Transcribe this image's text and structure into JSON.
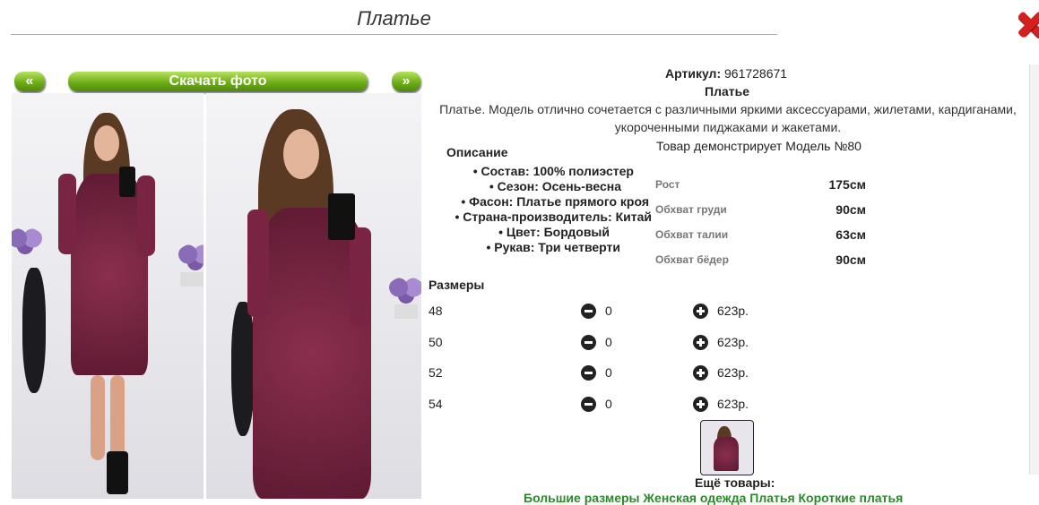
{
  "header": {
    "title": "Платье"
  },
  "gallery": {
    "prev_label": "«",
    "download_label": "Скачать фото",
    "next_label": "»"
  },
  "product": {
    "article_label": "Артикул:",
    "article_value": "961728671",
    "name": "Платье",
    "description_line1": "Платье. Модель отлично сочетается с различными яркими аксессуарами, жилетами, кардиганами,",
    "description_line2": "укороченными пиджаками и жакетами.",
    "model_note": "Товар демонстрирует Модель №80"
  },
  "specs": {
    "heading": "Описание",
    "items": [
      "• Состав: 100% полиэстер",
      "• Сезон: Осень-весна",
      "• Фасон: Платье прямого кроя",
      "• Страна-производитель: Китай",
      "• Цвет: Бордовый",
      "• Рукав: Три четверти"
    ]
  },
  "measurements": [
    {
      "label": "Рост",
      "value": "175см"
    },
    {
      "label": "Обхват груди",
      "value": "90см"
    },
    {
      "label": "Обхват талии",
      "value": "63см"
    },
    {
      "label": "Обхват бёдер",
      "value": "90см"
    }
  ],
  "sizes": {
    "heading": "Размеры",
    "rows": [
      {
        "size": "48",
        "qty": "0",
        "price": "623р."
      },
      {
        "size": "50",
        "qty": "0",
        "price": "623р."
      },
      {
        "size": "52",
        "qty": "0",
        "price": "623р."
      },
      {
        "size": "54",
        "qty": "0",
        "price": "623р."
      }
    ]
  },
  "more": {
    "heading": "Ещё товары:",
    "links_text": "Большие размеры   Женская одежда   Платья   Короткие платья"
  },
  "colors": {
    "accent_green": "#6fae18",
    "dress": "#6e1f3a",
    "close_red": "#d32020",
    "link_green": "#2a8a2a"
  },
  "icons": [
    "close-icon",
    "minus-circle-icon",
    "plus-circle-icon"
  ]
}
